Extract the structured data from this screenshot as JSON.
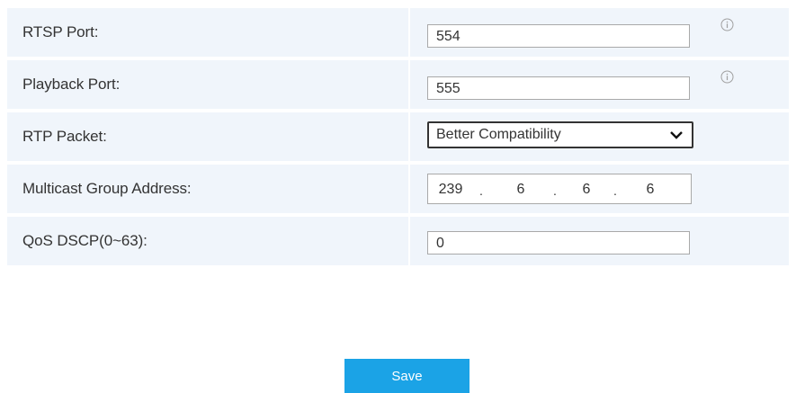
{
  "rows": [
    {
      "label": "RTSP Port:",
      "value": "554",
      "has_info": true
    },
    {
      "label": "Playback Port:",
      "value": "555",
      "has_info": true
    },
    {
      "label": "RTP Packet:",
      "selected": "Better Compatibility"
    },
    {
      "label": "Multicast Group Address:",
      "ip": [
        "239",
        "6",
        "6",
        "6"
      ]
    },
    {
      "label": "QoS DSCP(0~63):",
      "value": "0"
    }
  ],
  "icons": {
    "info": "info-circle-icon",
    "dropdown": "chevron-down-icon"
  },
  "save_label": "Save",
  "colors": {
    "row_bg": "#f0f5fb",
    "button_bg": "#1ba3e6",
    "button_text": "#ffffff"
  }
}
